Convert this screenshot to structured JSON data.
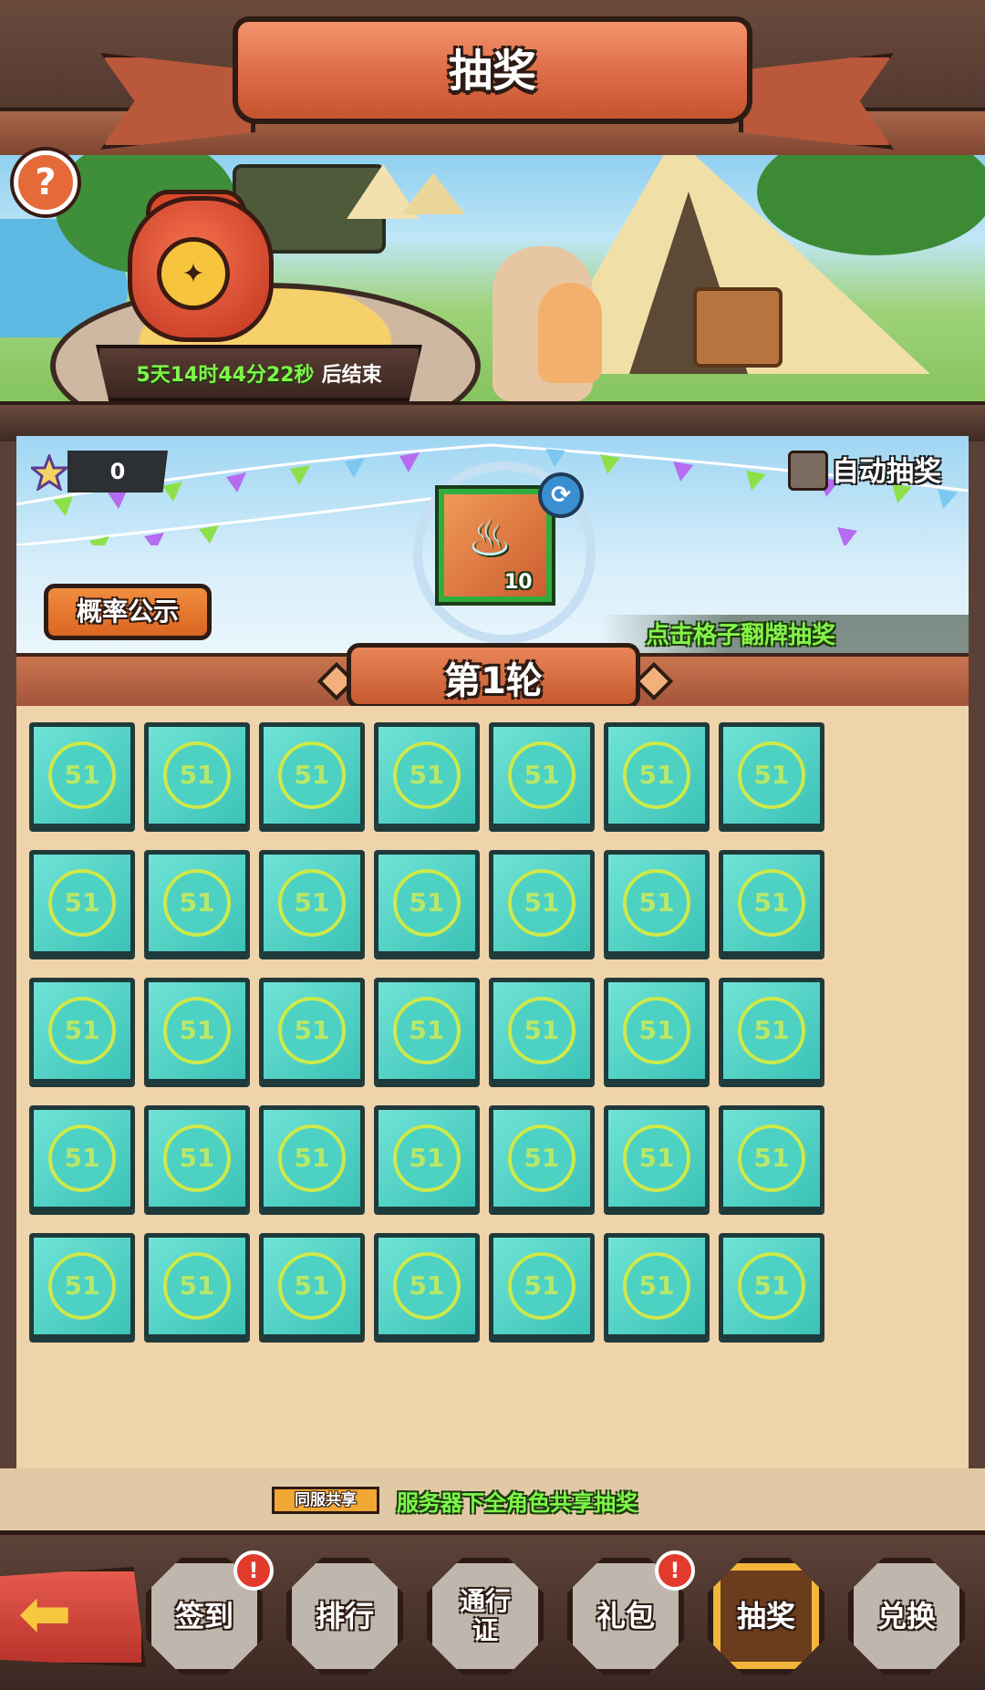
{
  "header": {
    "title": "抽奖"
  },
  "event": {
    "countdown": "5天14时44分22秒",
    "countdown_suffix": "后结束"
  },
  "currency": {
    "count": "0",
    "icon": "star-icon"
  },
  "auto_draw": {
    "label": "自动抽奖",
    "checked": false
  },
  "prize": {
    "quantity": "10",
    "icon": "flame-icon"
  },
  "odds_button": "概率公示",
  "hint": "点击格子翻牌抽奖",
  "round": {
    "label": "第1轮"
  },
  "grid": {
    "rows": 5,
    "cols": 7,
    "card_label": "51"
  },
  "shared": {
    "tag": "同服共享",
    "text": "服务器下全角色共享抽奖"
  },
  "nav": {
    "back_icon": "back-arrow-icon",
    "items": [
      {
        "label": "签到",
        "badge": "!",
        "active": false
      },
      {
        "label": "排行",
        "badge": "",
        "active": false
      },
      {
        "label": "通行证",
        "badge": "",
        "active": false
      },
      {
        "label": "礼包",
        "badge": "!",
        "active": false
      },
      {
        "label": "抽奖",
        "badge": "",
        "active": true
      },
      {
        "label": "兑换",
        "badge": "",
        "active": false
      }
    ]
  },
  "colors": {
    "card": "#3bc2b6",
    "accent_green": "#7ef64a",
    "ribbon": "#dd6b45"
  }
}
